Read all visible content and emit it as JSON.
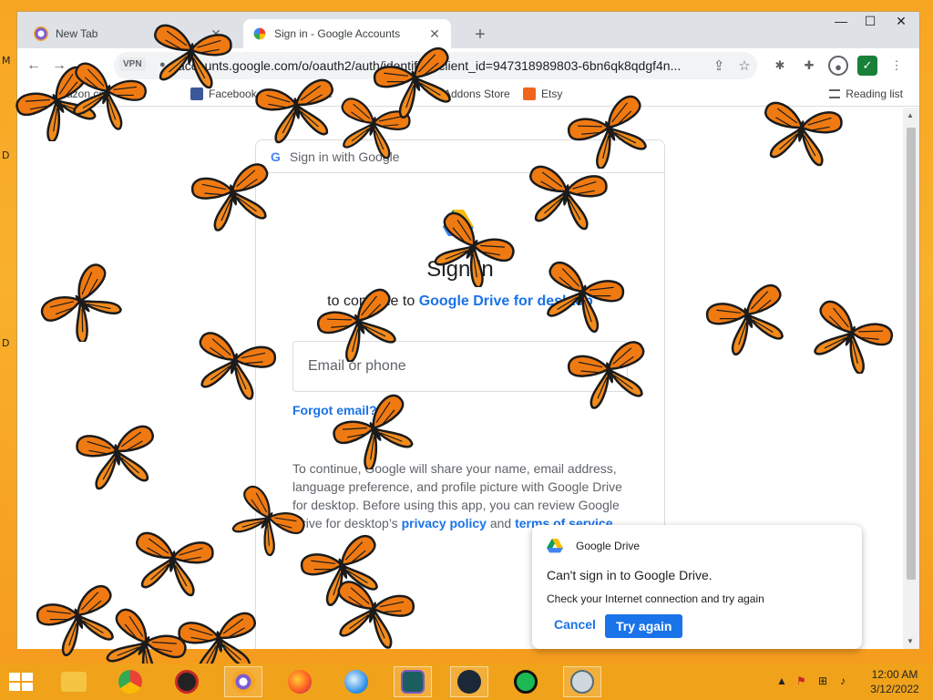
{
  "desktop": {
    "left_letters": [
      "M",
      "D",
      "D"
    ]
  },
  "browser": {
    "window_controls": {
      "minimize": "—",
      "maximize": "☐",
      "close": "✕"
    },
    "tabs": [
      {
        "title": "New Tab",
        "close": "✕"
      },
      {
        "title": "Sign in - Google Accounts",
        "close": "✕"
      }
    ],
    "new_tab": "+",
    "toolbar": {
      "back": "←",
      "forward": "→",
      "vpn": "VPN",
      "lock": "🔒",
      "url": "accounts.google.com/o/oauth2/auth/identifier?client_id=947318989803-6bn6qk8qdgf4n...",
      "share": "⇪",
      "star": "☆",
      "extension1": "✱",
      "extensions": "✚",
      "profile": "●",
      "shield": "✓",
      "menu": "⋮"
    },
    "bookmarks": [
      {
        "label": "mazon.co"
      },
      {
        "label": "Facebook"
      },
      {
        "label": "ube"
      },
      {
        "label": "Addons Store"
      },
      {
        "label": "Etsy"
      }
    ],
    "reading_list": "Reading list"
  },
  "signin": {
    "header": "Sign in with Google",
    "g_logo": "G",
    "title": "Sign in",
    "subtitle_prefix": "to continue to",
    "subtitle_link": "Google Drive for desktop",
    "email_placeholder": "Email or phone",
    "forgot": "Forgot email?",
    "consent_text": "To continue, Google will share your name, email address, language preference, and profile picture with Google Drive for desktop. Before using this app, you can review Google Drive for desktop’s",
    "privacy": "privacy policy",
    "and": "and",
    "terms": "terms of service"
  },
  "notification": {
    "app": "Google Drive",
    "title": "Can't sign in to Google Drive.",
    "body": "Check your Internet connection and try again",
    "cancel": "Cancel",
    "try_again": "Try again"
  },
  "taskbar": {
    "apps": [
      "file-explorer",
      "chrome",
      "game-app",
      "avast-browser",
      "firefox",
      "thunderbird",
      "vpn-app",
      "steam",
      "spotify",
      "network-app"
    ],
    "tray_arrow": "▲",
    "time": "12:00 AM",
    "date": "3/12/2022"
  },
  "colors": {
    "desktop_orange": "#f7a623",
    "google_blue": "#1a73e8",
    "butterfly_orange": "#f07a12",
    "butterfly_black": "#1b1b1b"
  }
}
